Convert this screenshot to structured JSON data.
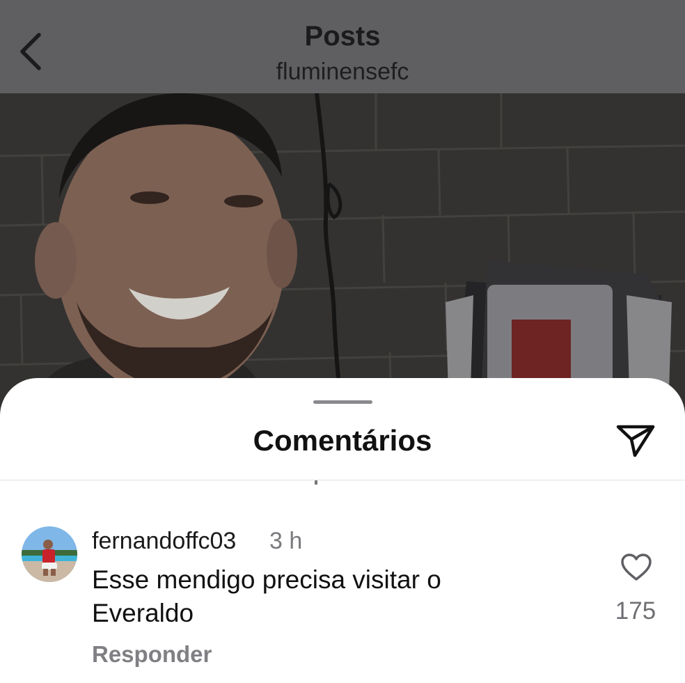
{
  "header": {
    "title": "Posts",
    "username": "fluminensefc"
  },
  "sheet": {
    "title": "Comentários"
  },
  "comment": {
    "username": "fernandoffc03",
    "time": "3 h",
    "text": "Esse mendigo precisa visitar o Everaldo",
    "likes": "175",
    "reply_label": "Responder"
  },
  "icons": {
    "back": "chevron-left-icon",
    "share": "paper-plane-icon",
    "like": "heart-icon"
  },
  "colors": {
    "header_bg": "#5f5f62",
    "sheet_bg": "#ffffff",
    "muted_text": "#7a7a7e"
  }
}
